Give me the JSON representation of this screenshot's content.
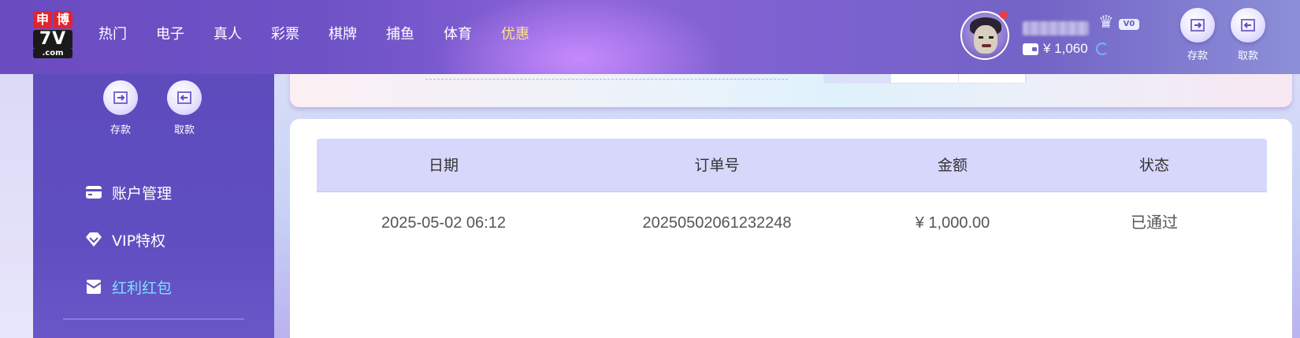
{
  "logo": {
    "char1": "申",
    "char2": "博",
    "main": "7V",
    "suffix": ".com"
  },
  "nav": {
    "items": [
      {
        "label": "热门"
      },
      {
        "label": "电子"
      },
      {
        "label": "真人"
      },
      {
        "label": "彩票"
      },
      {
        "label": "棋牌"
      },
      {
        "label": "捕鱼"
      },
      {
        "label": "体育"
      },
      {
        "label": "优惠",
        "active": true
      }
    ]
  },
  "user": {
    "vip_level": "V0",
    "balance": "¥ 1,060"
  },
  "header_actions": {
    "deposit": "存款",
    "withdraw": "取款"
  },
  "sidebar": {
    "deposit": "存款",
    "withdraw": "取款",
    "menu": [
      {
        "label": "账户管理",
        "icon": "card-icon"
      },
      {
        "label": "VIP特权",
        "icon": "diamond-icon"
      },
      {
        "label": "红利红包",
        "icon": "envelope-icon",
        "active": true
      }
    ]
  },
  "table": {
    "headers": [
      "日期",
      "订单号",
      "金额",
      "状态"
    ],
    "rows": [
      {
        "date": "2025-05-02 06:12",
        "order_no": "20250502061232248",
        "amount": "¥ 1,000.00",
        "status": "已通过"
      }
    ]
  },
  "colors": {
    "accent": "#5f4ec0",
    "active_nav": "#ffe38a",
    "active_menu": "#7de0ff",
    "table_header": "#d7d7fb"
  }
}
